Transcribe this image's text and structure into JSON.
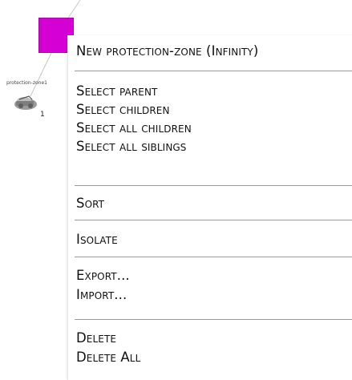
{
  "canvas": {
    "parent_node_color": "#d400d4",
    "child_node": {
      "label": "protection-zone1",
      "count": "1"
    }
  },
  "context_menu": {
    "groups": [
      {
        "items": [
          {
            "id": "new-protection-zone",
            "label": "New protection-zone (Infinity)"
          }
        ]
      },
      {
        "items": [
          {
            "id": "select-parent",
            "label": "Select parent"
          },
          {
            "id": "select-children",
            "label": "Select children"
          },
          {
            "id": "select-all-children",
            "label": "Select all children"
          },
          {
            "id": "select-all-siblings",
            "label": "Select all siblings"
          }
        ]
      },
      {
        "items": [
          {
            "id": "sort",
            "label": "Sort"
          }
        ]
      },
      {
        "items": [
          {
            "id": "isolate",
            "label": "Isolate"
          }
        ]
      },
      {
        "items": [
          {
            "id": "export",
            "label": "Export..."
          },
          {
            "id": "import",
            "label": "Import..."
          }
        ]
      },
      {
        "items": [
          {
            "id": "delete",
            "label": "Delete"
          },
          {
            "id": "delete-all",
            "label": "Delete All"
          }
        ]
      }
    ]
  }
}
